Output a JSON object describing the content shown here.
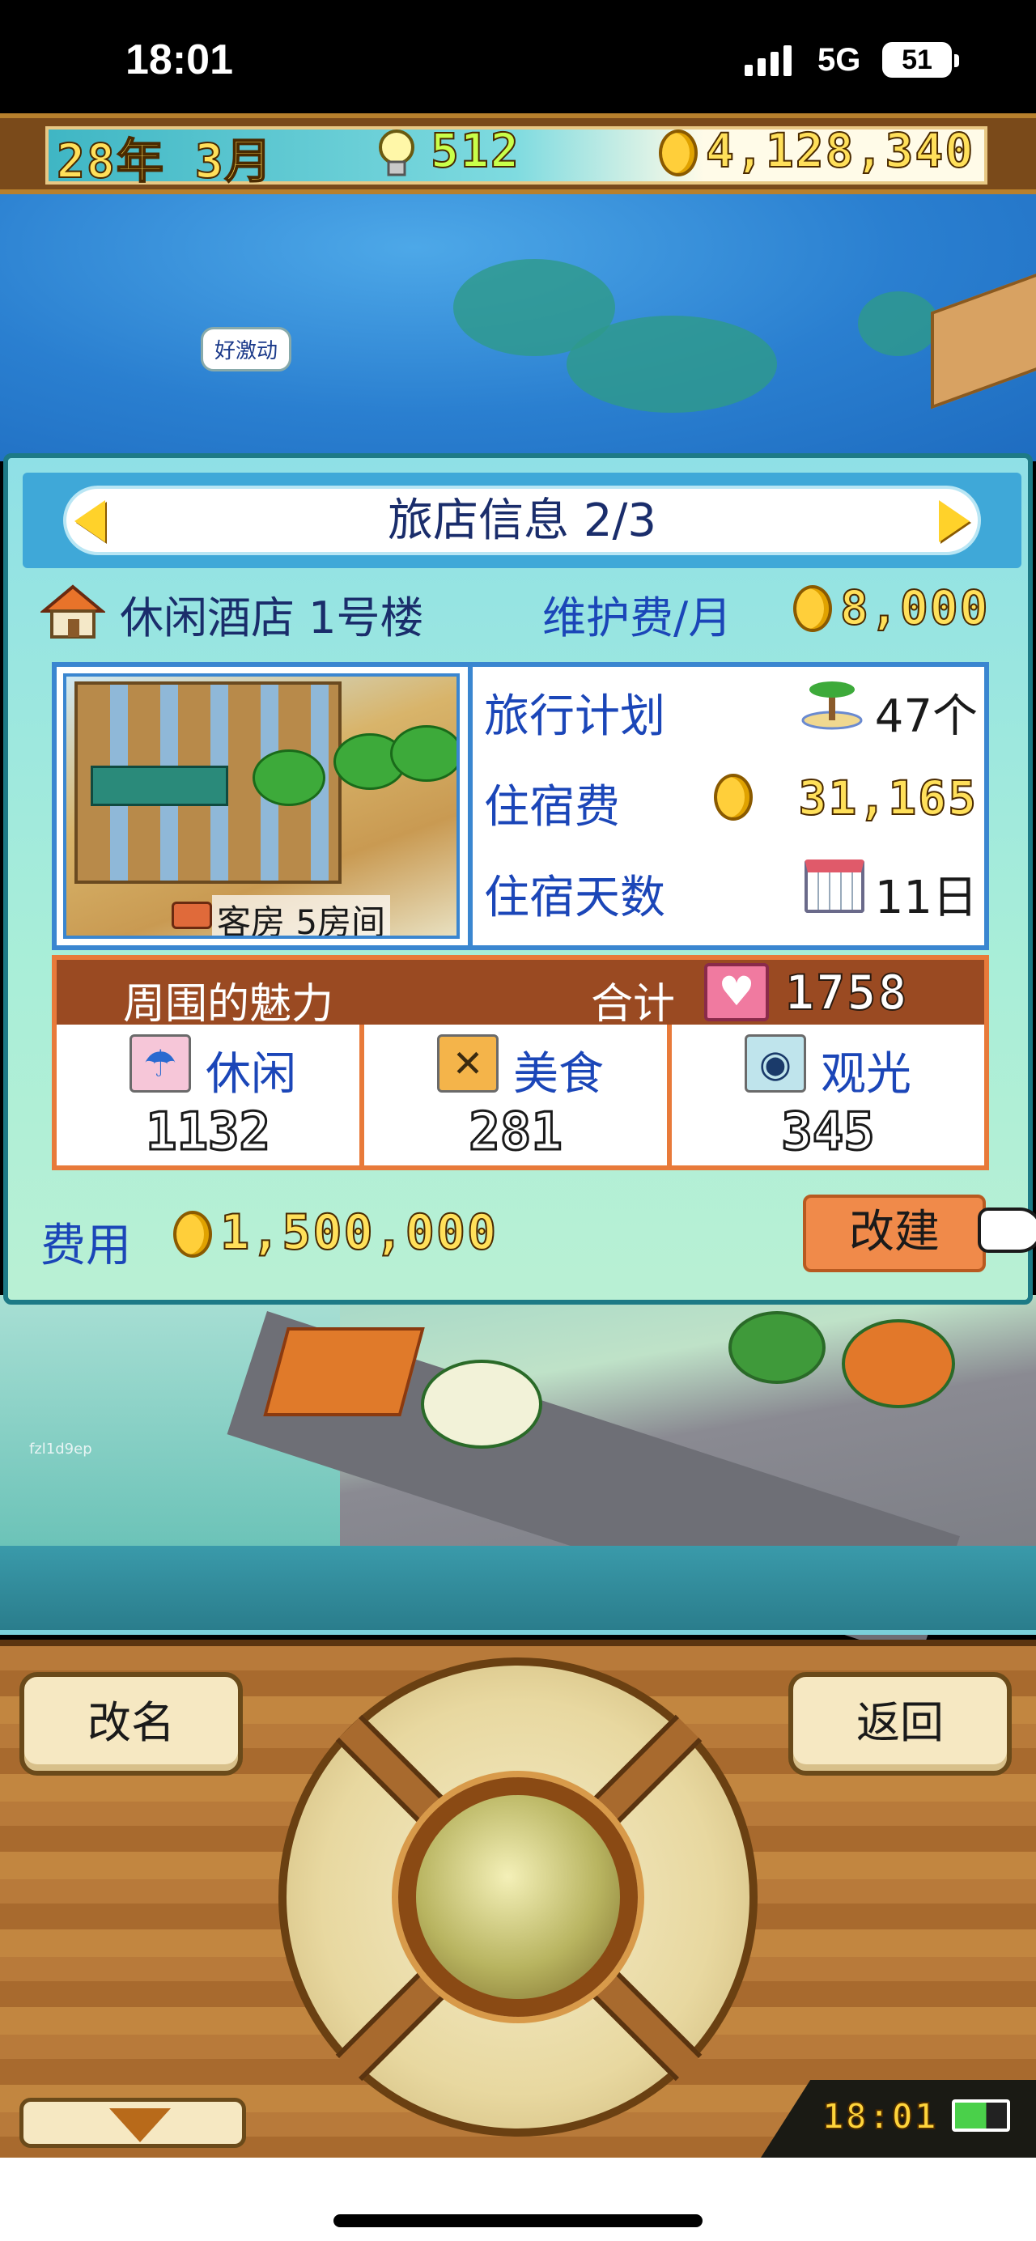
{
  "status_bar": {
    "time": "18:01",
    "network": "5G",
    "battery": "51"
  },
  "top_bar": {
    "date": "28年 3月",
    "bulbs": "512",
    "money": "4,128,340"
  },
  "speech_bubble": "好激动",
  "watermark": "fzl1d9ep",
  "panel": {
    "title": "旅店信息 2/3",
    "hotel_name": "休闲酒店 1号楼",
    "upkeep_label": "维护费/月",
    "upkeep_value": "8,000",
    "room_tag": "客房 5房间",
    "stats": [
      {
        "label": "旅行计划",
        "value": "47个",
        "icon": "island-icon"
      },
      {
        "label": "住宿费",
        "value": "31,165",
        "icon": "coin-icon"
      },
      {
        "label": "住宿天数",
        "value": "11日",
        "icon": "calendar-icon"
      }
    ],
    "charm": {
      "title": "周围的魅力",
      "total_label": "合计",
      "total": "1758",
      "cells": [
        {
          "label": "休闲",
          "value": "1132",
          "icon": "umbrella-icon"
        },
        {
          "label": "美食",
          "value": "281",
          "icon": "cutlery-icon"
        },
        {
          "label": "观光",
          "value": "345",
          "icon": "camera-icon"
        }
      ]
    },
    "cost_label": "费用",
    "cost_value": "1,500,000",
    "rebuild_label": "改建"
  },
  "controls": {
    "rename_label": "改名",
    "back_label": "返回",
    "clock": "18:01"
  },
  "colors": {
    "panel_bg": "#a9eed8",
    "title_bar": "#3fa8d8",
    "label_blue": "#1b46b8",
    "charm_header": "#9a4a22",
    "rebuild_button": "#f08a4a"
  }
}
